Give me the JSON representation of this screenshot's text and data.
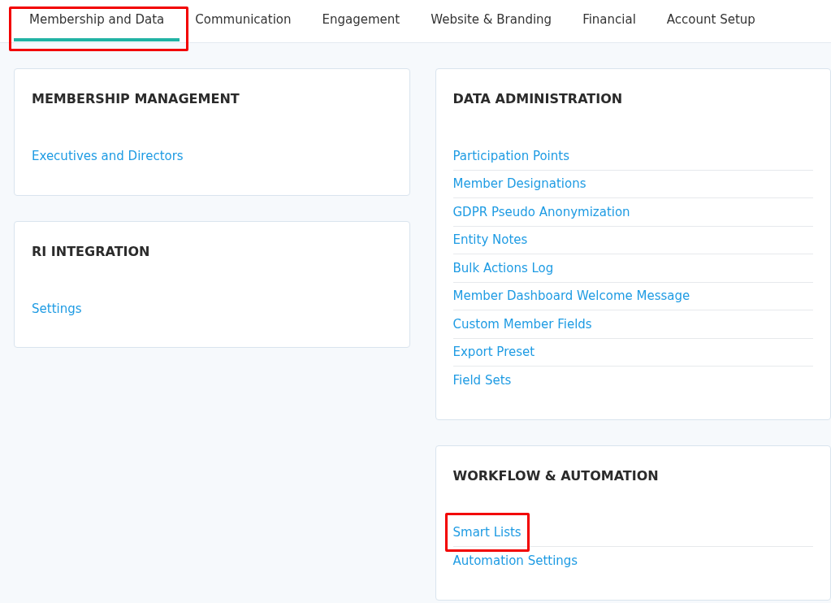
{
  "tabs": [
    {
      "label": "Membership and Data",
      "selected": true,
      "highlighted": true
    },
    {
      "label": "Communication",
      "selected": false,
      "highlighted": false
    },
    {
      "label": "Engagement",
      "selected": false,
      "highlighted": false
    },
    {
      "label": "Website & Branding",
      "selected": false,
      "highlighted": false
    },
    {
      "label": "Financial",
      "selected": false,
      "highlighted": false
    },
    {
      "label": "Account Setup",
      "selected": false,
      "highlighted": false
    }
  ],
  "columns": [
    {
      "cards": [
        {
          "title": "MEMBERSHIP MANAGEMENT",
          "links": [
            {
              "label": "Executives and Directors",
              "highlighted": false
            }
          ]
        },
        {
          "title": "RI INTEGRATION",
          "links": [
            {
              "label": "Settings",
              "highlighted": false
            }
          ]
        }
      ]
    },
    {
      "cards": [
        {
          "title": "DATA ADMINISTRATION",
          "links": [
            {
              "label": "Participation Points",
              "highlighted": false
            },
            {
              "label": "Member Designations",
              "highlighted": false
            },
            {
              "label": "GDPR Pseudo Anonymization",
              "highlighted": false
            },
            {
              "label": "Entity Notes",
              "highlighted": false
            },
            {
              "label": "Bulk Actions Log",
              "highlighted": false
            },
            {
              "label": "Member Dashboard Welcome Message",
              "highlighted": false
            },
            {
              "label": "Custom Member Fields",
              "highlighted": false
            },
            {
              "label": "Export Preset",
              "highlighted": false
            },
            {
              "label": "Field Sets",
              "highlighted": false
            }
          ]
        },
        {
          "title": "WORKFLOW & AUTOMATION",
          "links": [
            {
              "label": "Smart Lists",
              "highlighted": true
            },
            {
              "label": "Automation Settings",
              "highlighted": false
            }
          ]
        }
      ]
    }
  ]
}
